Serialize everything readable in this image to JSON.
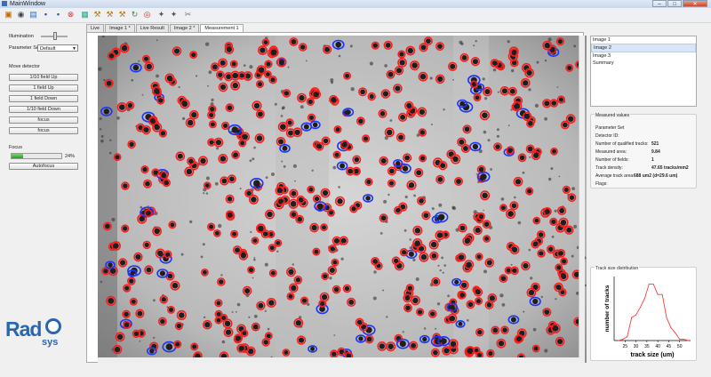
{
  "window": {
    "title": "MainWindow",
    "buttons": [
      "–",
      "□",
      "✕"
    ]
  },
  "toolbar": {
    "icons": [
      "open-icon",
      "camera-icon",
      "image-icon",
      "save-icon",
      "save-as-icon",
      "close-red-icon",
      "grid-icon",
      "measure-icon",
      "measure2-icon",
      "measure3-icon",
      "refresh-icon",
      "target-icon",
      "magic-icon",
      "magic2-icon",
      "tools-icon"
    ]
  },
  "left": {
    "illumination_label": "Illumination",
    "illumination_level": 0.5,
    "parameter_set_label": "Parameter Set",
    "parameter_set_value": "Default",
    "move_detector_label": "Move detector",
    "buttons": [
      "1/10 field Up",
      "1 field Up",
      "1 field Down",
      "1/10 field Down",
      "focus",
      "focus"
    ],
    "focus_label": "Focus",
    "focus_percent": 24,
    "focus_percent_text": "24%",
    "autofocus_label": "Autofocus",
    "logo_text_1": "Rad",
    "logo_text_2": "sys"
  },
  "tabs": [
    "Live",
    "Image 1 *",
    "Live Result",
    "Image 2 *",
    "Measurement 1"
  ],
  "list": {
    "items": [
      "Image 1",
      "Image 2",
      "Image 3",
      "Summary"
    ],
    "selected": 1
  },
  "measured": {
    "title": "Measured values",
    "rows": [
      {
        "label": "Parameter Set",
        "value": ""
      },
      {
        "label": "Detector ID:",
        "value": ""
      },
      {
        "label": "Number of qualified tracks:",
        "value": "521"
      },
      {
        "label": "Measured area:",
        "value": "9.84"
      },
      {
        "label": "Number of fields:",
        "value": "1"
      },
      {
        "label": "Track density:",
        "value": "47.65 tracks/mm2"
      },
      {
        "label": "Average track area:",
        "value": "688 um2 (d=29.6 um)"
      },
      {
        "label": "Flags:",
        "value": ""
      }
    ]
  },
  "distribution": {
    "title": "Track size distribution"
  },
  "chart_data": {
    "type": "line",
    "title": "",
    "xlabel": "track size (um)",
    "ylabel": "number of tracks",
    "x": [
      22,
      24,
      26,
      28,
      30,
      32,
      34,
      36,
      38,
      40,
      42,
      44,
      46,
      48,
      50,
      52,
      54
    ],
    "values": [
      0,
      1,
      3,
      18,
      20,
      26,
      33,
      44,
      44,
      36,
      36,
      18,
      10,
      6,
      1,
      1,
      0
    ],
    "xticks": [
      "25",
      "30",
      "35",
      "40",
      "45",
      "50"
    ],
    "xlim": [
      20,
      55
    ],
    "ylim": [
      0,
      50
    ],
    "color": "#ff3b3b",
    "grid": false
  },
  "colors": {
    "selected_track": "#ff1a1a",
    "rejected_track": "#1a33ff",
    "accent": "#2a7fd0"
  }
}
